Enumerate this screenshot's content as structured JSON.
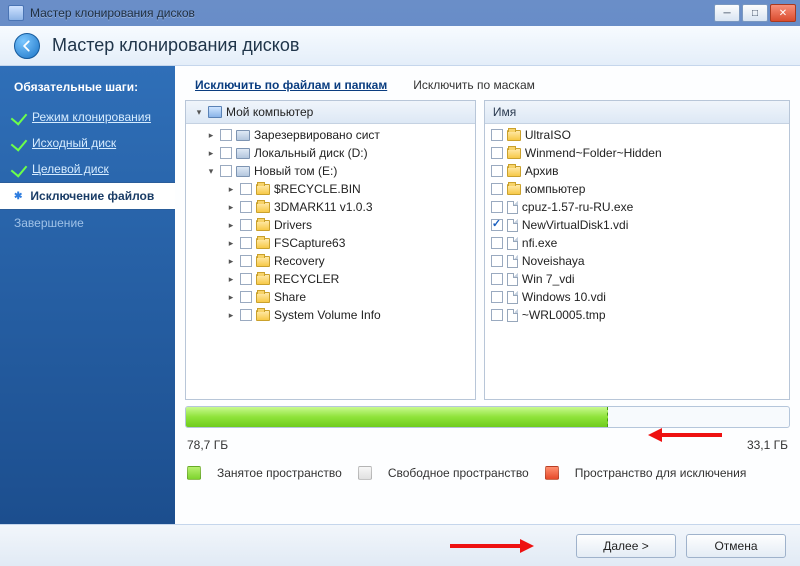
{
  "window": {
    "title": "Мастер клонирования дисков"
  },
  "header": {
    "title": "Мастер клонирования дисков"
  },
  "sidebar": {
    "title": "Обязательные шаги:",
    "steps": [
      {
        "label": "Режим клонирования"
      },
      {
        "label": "Исходный диск"
      },
      {
        "label": "Целевой диск"
      },
      {
        "label": "Исключение файлов"
      },
      {
        "label": "Завершение"
      }
    ]
  },
  "tabs": {
    "by_files": "Исключить по файлам и папкам",
    "by_masks": "Исключить по маскам"
  },
  "left_pane": {
    "root": "Мой компьютер",
    "items": [
      {
        "label": "Зарезервировано сист",
        "icon": "drive"
      },
      {
        "label": "Локальный диск (D:)",
        "icon": "drive"
      },
      {
        "label": "Новый том (E:)",
        "icon": "drive",
        "expanded": true,
        "children": [
          {
            "label": "$RECYCLE.BIN"
          },
          {
            "label": "3DMARK11 v1.0.3"
          },
          {
            "label": "Drivers"
          },
          {
            "label": "FSCapture63"
          },
          {
            "label": "Recovery"
          },
          {
            "label": "RECYCLER"
          },
          {
            "label": "Share"
          },
          {
            "label": "System Volume Info"
          }
        ]
      }
    ]
  },
  "right_pane": {
    "header": "Имя",
    "items": [
      {
        "label": "UltraISO",
        "icon": "folder"
      },
      {
        "label": "Winmend~Folder~Hidden",
        "icon": "folder"
      },
      {
        "label": "Архив",
        "icon": "folder"
      },
      {
        "label": "компьютер",
        "icon": "folder"
      },
      {
        "label": "cpuz-1.57-ru-RU.exe",
        "icon": "file"
      },
      {
        "label": "NewVirtualDisk1.vdi",
        "icon": "file",
        "checked": true
      },
      {
        "label": "nfi.exe",
        "icon": "file"
      },
      {
        "label": "Noveishaya",
        "icon": "file"
      },
      {
        "label": "Win 7_vdi",
        "icon": "file"
      },
      {
        "label": "Windows 10.vdi",
        "icon": "file"
      },
      {
        "label": "~WRL0005.tmp",
        "icon": "file"
      }
    ]
  },
  "capacity": {
    "used_label": "78,7 ГБ",
    "free_label": "33,1 ГБ",
    "used_percent": 70
  },
  "legend": {
    "used": "Занятое пространство",
    "free": "Свободное пространство",
    "excluded": "Пространство для исключения"
  },
  "footer": {
    "next": "Далее >",
    "cancel": "Отмена"
  }
}
